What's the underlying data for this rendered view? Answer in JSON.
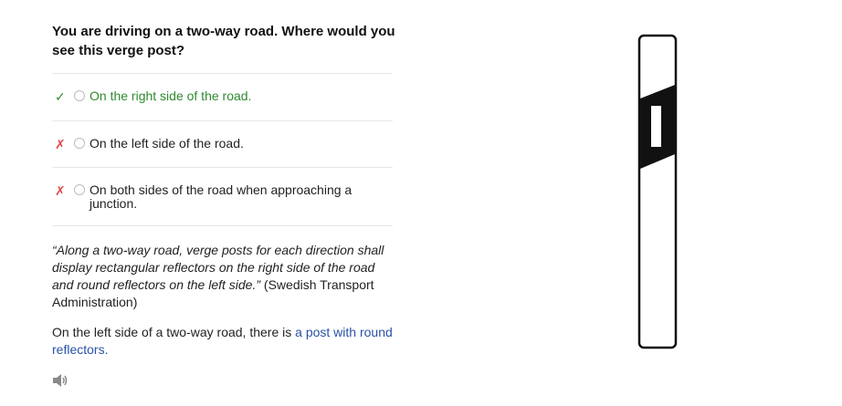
{
  "question": {
    "text": "You are driving on a two-way road. Where would you see this verge post?"
  },
  "answers": [
    {
      "mark": "✓",
      "status": "correct",
      "text": "On the right side of the road."
    },
    {
      "mark": "✗",
      "status": "incorrect",
      "text": "On the left side of the road."
    },
    {
      "mark": "✗",
      "status": "incorrect",
      "text": "On both sides of the road when approaching a junction."
    }
  ],
  "explanation": {
    "quote": "“Along a two-way road, verge posts for each direction shall display rectangular reflectors on the right side of the road and round reflectors on the left side.”",
    "source": " (Swedish Transport Administration)"
  },
  "more": {
    "prefix": "On the left side of a two-way road, there is ",
    "link": "a post with round reflectors."
  },
  "audio": {
    "icon": "speaker-icon"
  },
  "colors": {
    "correct": "#2e8b2e",
    "incorrect": "#e04848",
    "link": "#2a52a6",
    "divider": "#e8e8e8"
  }
}
